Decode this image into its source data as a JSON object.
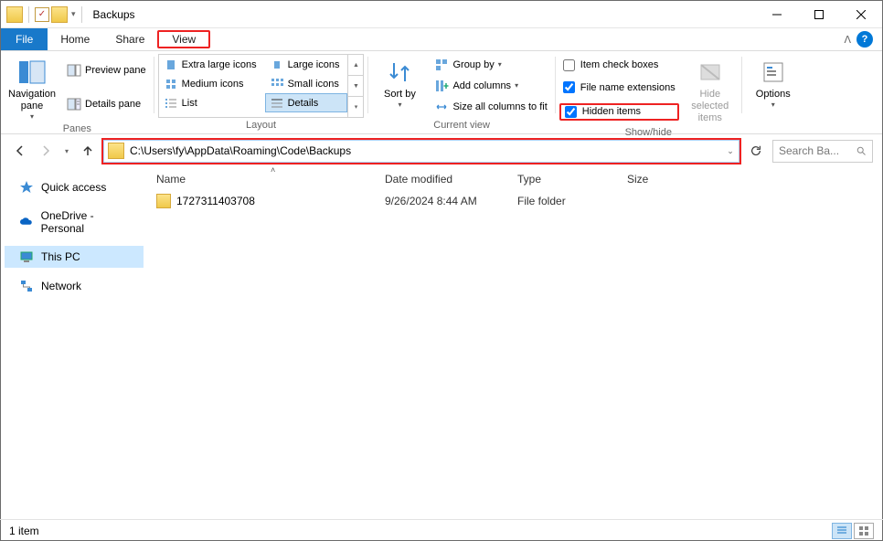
{
  "titlebar": {
    "title": "Backups"
  },
  "tabs": {
    "file": "File",
    "home": "Home",
    "share": "Share",
    "view": "View"
  },
  "ribbon": {
    "panes": {
      "navigation_pane": "Navigation pane",
      "preview_pane": "Preview pane",
      "details_pane": "Details pane",
      "group_label": "Panes"
    },
    "layout": {
      "extra_large": "Extra large icons",
      "large": "Large icons",
      "medium": "Medium icons",
      "small": "Small icons",
      "list": "List",
      "details": "Details",
      "group_label": "Layout"
    },
    "current_view": {
      "sort_by": "Sort by",
      "group_by": "Group by",
      "add_columns": "Add columns",
      "size_all": "Size all columns to fit",
      "group_label": "Current view"
    },
    "show_hide": {
      "item_check": "Item check boxes",
      "file_ext": "File name extensions",
      "hidden": "Hidden items",
      "hide_selected": "Hide selected items",
      "group_label": "Show/hide"
    },
    "options": "Options"
  },
  "address": {
    "path": "C:\\Users\\fy\\AppData\\Roaming\\Code\\Backups",
    "search_placeholder": "Search Ba..."
  },
  "navpane": {
    "quick_access": "Quick access",
    "onedrive": "OneDrive - Personal",
    "this_pc": "This PC",
    "network": "Network"
  },
  "columns": {
    "name": "Name",
    "date": "Date modified",
    "type": "Type",
    "size": "Size"
  },
  "items": [
    {
      "name": "1727311403708",
      "date": "9/26/2024 8:44 AM",
      "type": "File folder",
      "size": ""
    }
  ],
  "status": {
    "text": "1 item"
  },
  "checks": {
    "item_check": false,
    "file_ext": true,
    "hidden": true
  }
}
